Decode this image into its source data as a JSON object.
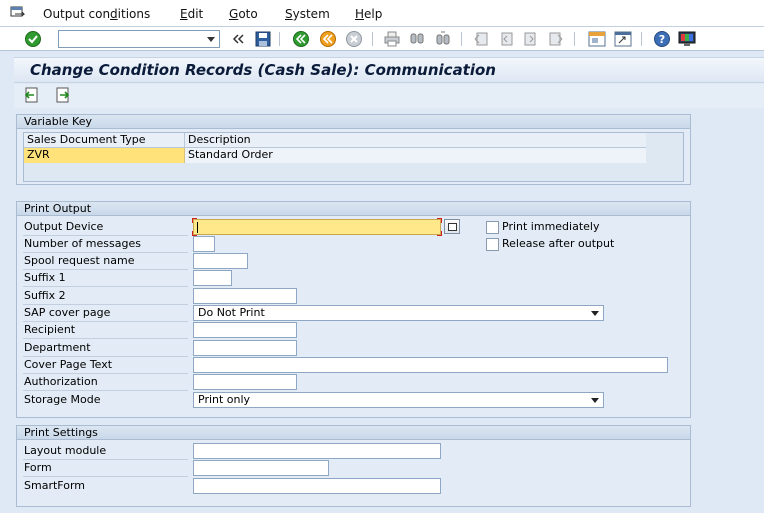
{
  "menu": {
    "items": [
      {
        "pre": "Output con",
        "u": "d",
        "post": "itions"
      },
      {
        "pre": "",
        "u": "E",
        "post": "dit"
      },
      {
        "pre": "",
        "u": "G",
        "post": "oto"
      },
      {
        "pre": "",
        "u": "S",
        "post": "ystem"
      },
      {
        "pre": "",
        "u": "H",
        "post": "elp"
      }
    ]
  },
  "toolbar": {
    "command_value": "",
    "icons": [
      "enter-icon",
      "back-double-icon",
      "save-icon",
      "back-icon",
      "exit-icon",
      "cancel-icon",
      "print-icon",
      "find-icon",
      "find-next-icon",
      "first-page-icon",
      "prev-page-icon",
      "next-page-icon",
      "last-page-icon",
      "create-session-icon",
      "shortcut-icon",
      "help-icon",
      "customize-layout-icon"
    ]
  },
  "title": "Change Condition Records (Cash Sale): Communication",
  "variable_key": {
    "header": "Variable Key",
    "columns": [
      "Sales Document Type",
      "Description"
    ],
    "rows": [
      {
        "type": "ZVR",
        "description": "Standard Order"
      }
    ]
  },
  "print_output": {
    "header": "Print Output",
    "fields": {
      "output_device": {
        "label": "Output Device",
        "value": ""
      },
      "num_messages": {
        "label": "Number of messages",
        "value": ""
      },
      "spool_name": {
        "label": "Spool request name",
        "value": ""
      },
      "suffix1": {
        "label": "Suffix 1",
        "value": ""
      },
      "suffix2": {
        "label": "Suffix 2",
        "value": ""
      },
      "cover_page": {
        "label": "SAP cover page",
        "value": "Do Not Print"
      },
      "recipient": {
        "label": "Recipient",
        "value": ""
      },
      "department": {
        "label": "Department",
        "value": ""
      },
      "cover_text": {
        "label": "Cover Page Text",
        "value": ""
      },
      "authorization": {
        "label": "Authorization",
        "value": ""
      },
      "storage_mode": {
        "label": "Storage Mode",
        "value": "Print only"
      }
    },
    "print_immediately": {
      "label": "Print immediately",
      "checked": false
    },
    "release_after_output": {
      "label": "Release after output",
      "checked": false
    }
  },
  "print_settings": {
    "header": "Print Settings",
    "fields": {
      "layout_module": {
        "label": "Layout module",
        "value": ""
      },
      "form": {
        "label": "Form",
        "value": ""
      },
      "smartform": {
        "label": "SmartForm",
        "value": ""
      }
    }
  }
}
